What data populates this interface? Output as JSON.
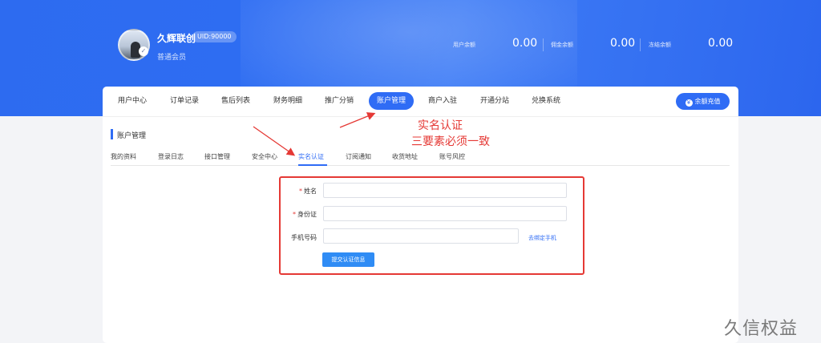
{
  "header": {
    "user_name": "久辉联创",
    "uid_badge": "UID:90000",
    "member_level": "普通会员",
    "stats": [
      {
        "label": "用户余额",
        "value": "0.00"
      },
      {
        "label": "佣金余额",
        "value": "0.00"
      },
      {
        "label": "冻结余额",
        "value": "0.00"
      }
    ]
  },
  "topnav": {
    "items": [
      {
        "label": "用户中心"
      },
      {
        "label": "订单记录"
      },
      {
        "label": "售后列表"
      },
      {
        "label": "财务明细"
      },
      {
        "label": "推广分销"
      },
      {
        "label": "账户管理",
        "active": true
      },
      {
        "label": "商户入驻"
      },
      {
        "label": "开通分站"
      },
      {
        "label": "兑换系统"
      }
    ],
    "recharge_label": "余额充值"
  },
  "section": {
    "title": "账户管理"
  },
  "subtabs": {
    "items": [
      {
        "label": "我的资料"
      },
      {
        "label": "登录日志"
      },
      {
        "label": "接口管理"
      },
      {
        "label": "安全中心"
      },
      {
        "label": "实名认证",
        "active": true
      },
      {
        "label": "订阅通知"
      },
      {
        "label": "收货地址"
      },
      {
        "label": "账号风控"
      }
    ]
  },
  "annotation": {
    "line1": "实名认证",
    "line2": "三要素必须一致",
    "color": "#e53935"
  },
  "form": {
    "required_mark": "*",
    "name_label": "姓名",
    "id_label": "身份证",
    "phone_label": "手机号码",
    "bind_phone_link": "去绑定手机",
    "submit_label": "提交认证信息"
  },
  "watermark": "久信权益",
  "colors": {
    "accent": "#2f6cf5",
    "banner": "#2e6df2"
  }
}
